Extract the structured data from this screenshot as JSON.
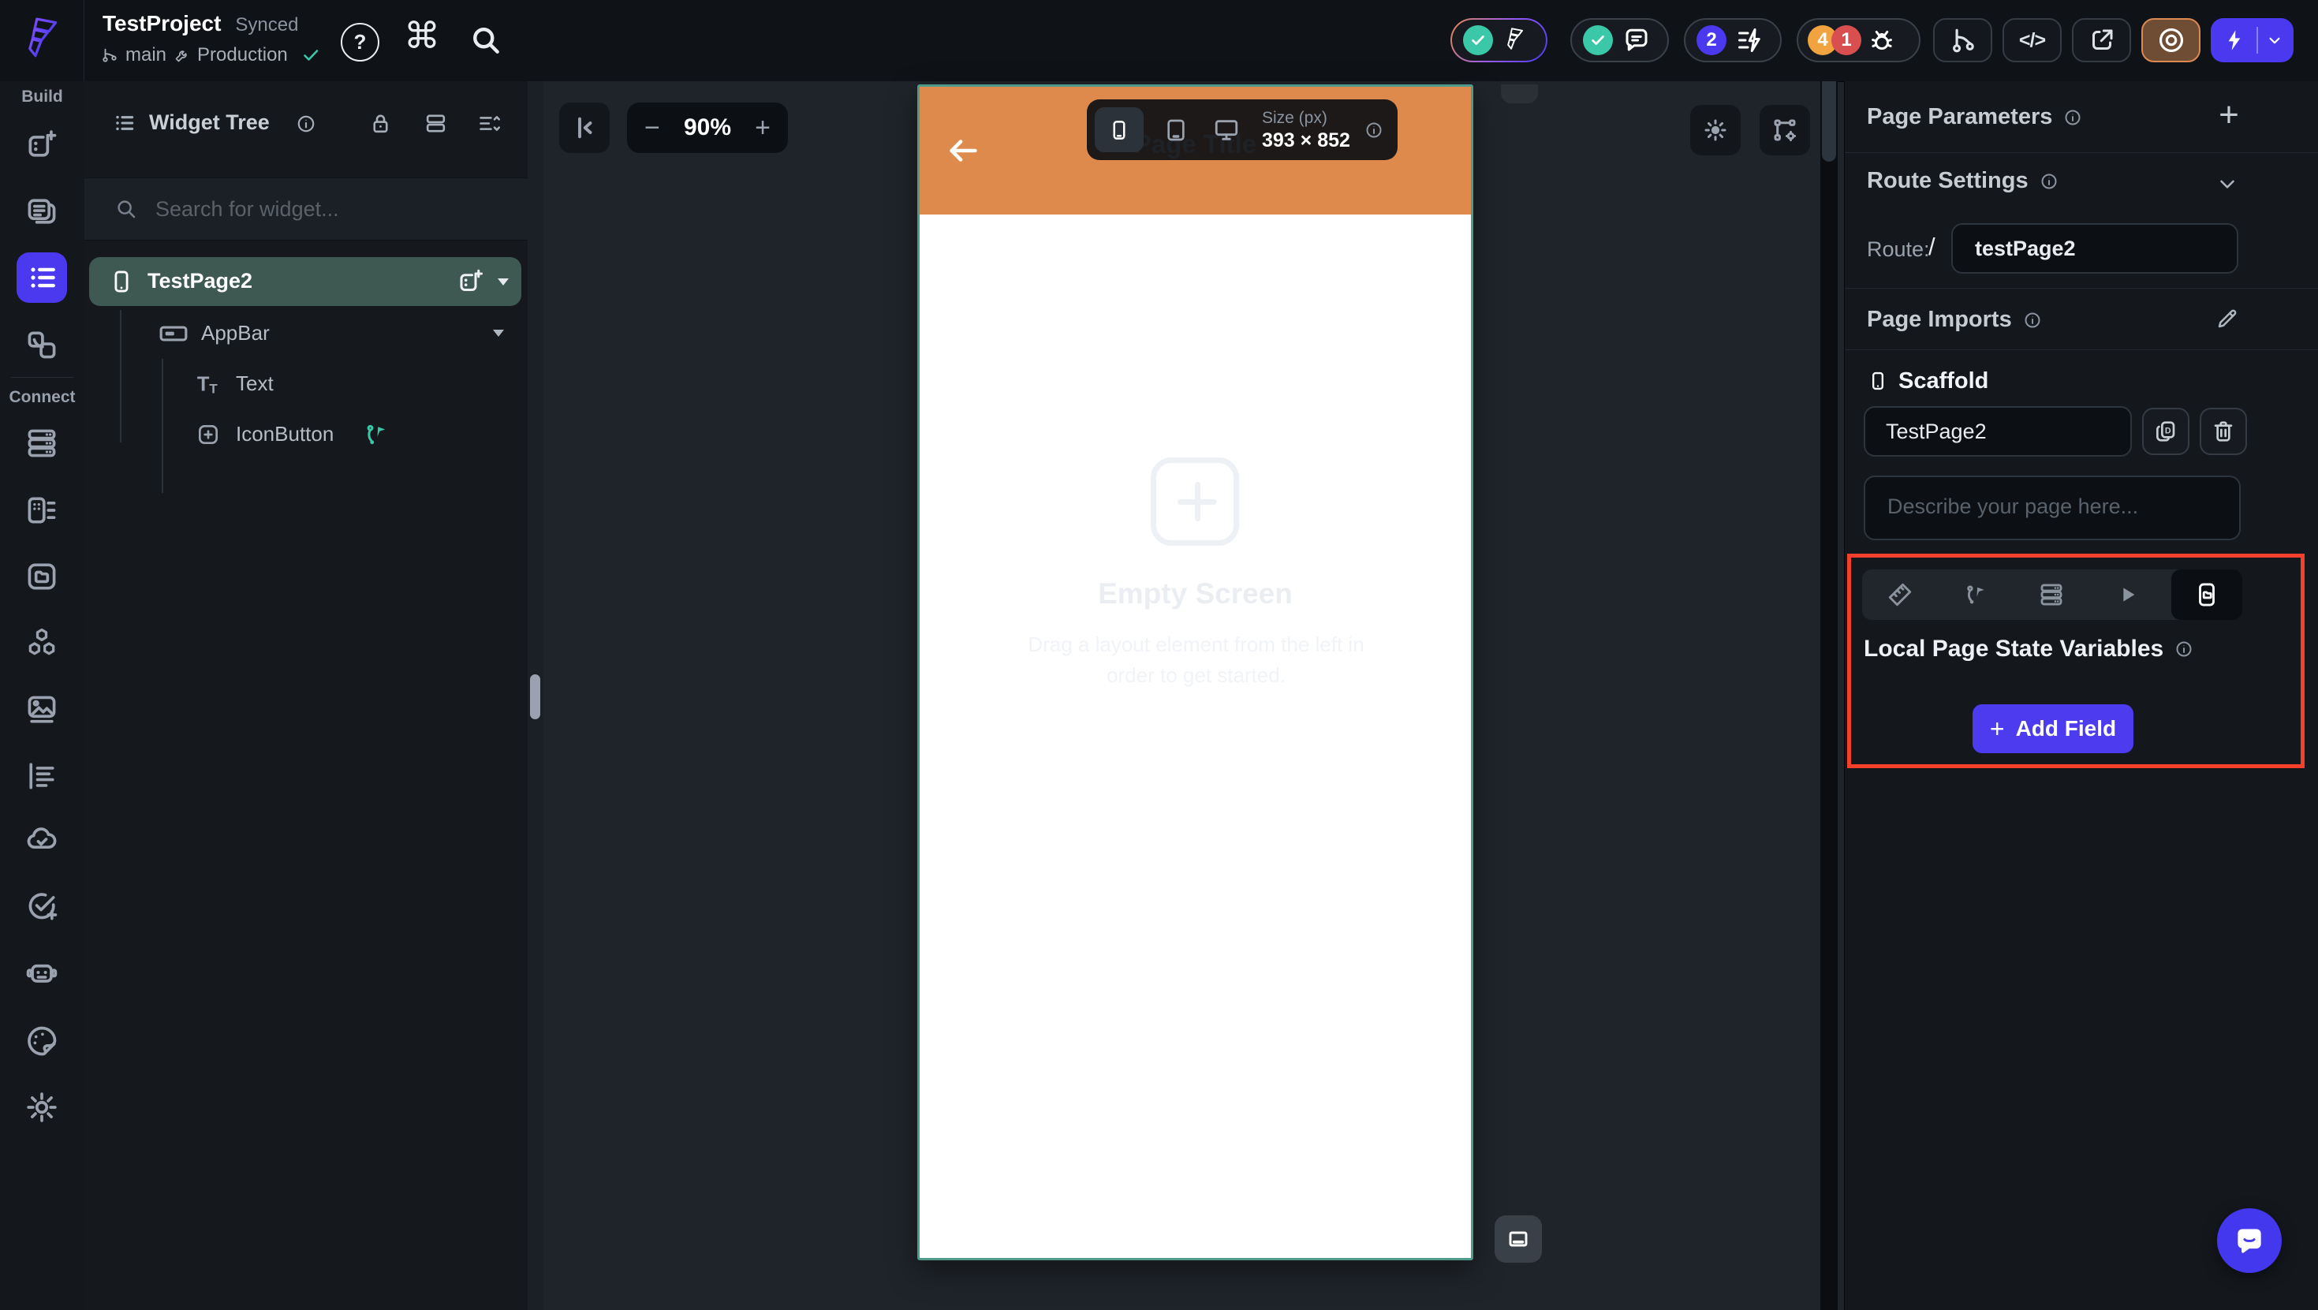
{
  "topbar": {
    "project_name": "TestProject",
    "sync_status": "Synced",
    "branch": "main",
    "environment": "Production",
    "badge_lint": "2",
    "badge_warnings": "4",
    "badge_errors": "1"
  },
  "sidebar": {
    "build_label": "Build",
    "connect_label": "Connect"
  },
  "widget_tree": {
    "title": "Widget Tree",
    "search_placeholder": "Search for widget...",
    "nodes": [
      {
        "label": "TestPage2"
      },
      {
        "label": "AppBar"
      },
      {
        "label": "Text"
      },
      {
        "label": "IconButton"
      }
    ]
  },
  "canvas": {
    "zoom_level": "90%",
    "size_label": "Size (px)",
    "size_value": "393 × 852",
    "page_title": "Page Title",
    "empty_title": "Empty Screen",
    "empty_description": "Drag a layout element from the left in order to get started."
  },
  "right_panel": {
    "page_parameters_title": "Page Parameters",
    "route_settings_title": "Route Settings",
    "route_label": "Route:",
    "route_prefix": "/",
    "route_value": "testPage2",
    "page_imports_title": "Page Imports",
    "scaffold_title": "Scaffold",
    "page_name_value": "TestPage2",
    "description_placeholder": "Describe your page here...",
    "local_state_title": "Local Page State Variables",
    "add_field_label": "Add Field"
  },
  "icons": {
    "help": "?",
    "command": "⌘",
    "code": "</>",
    "minus": "−",
    "plus": "+"
  },
  "colors": {
    "accent_indigo": "#4B39EF",
    "appbar_orange": "#DE8A4C",
    "selection_teal": "#3E5852",
    "success_teal": "#3BC8A9",
    "warning_orange": "#F0A33F",
    "error_red": "#D94F4F",
    "annotation_red": "#F5402C"
  }
}
